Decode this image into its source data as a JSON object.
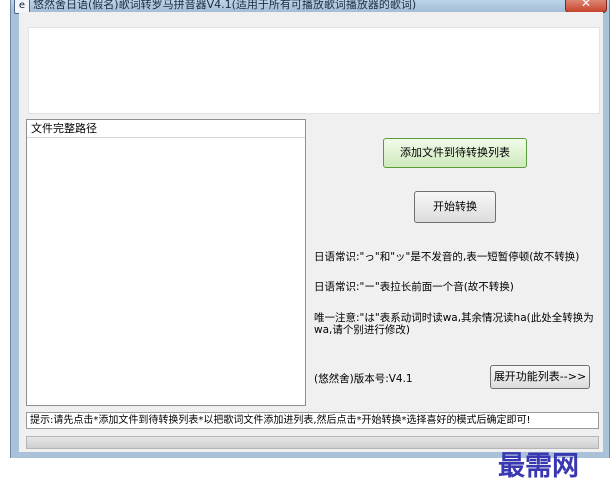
{
  "window": {
    "title": "悠然舍日语(假名)歌词转罗马拼音器V4.1(适用于所有可播放歌词播放器的歌词)",
    "close_glyph": "✕",
    "icon_name": "app-logo-icon"
  },
  "file_list": {
    "header": "文件完整路径"
  },
  "buttons": {
    "add_files": "添加文件到待转换列表",
    "start": "开始转换",
    "expand": "展开功能列表-->>"
  },
  "notes": {
    "tip1": "日语常识:\"っ\"和\"ッ\"是不发音的,表一短暂停顿(故不转换)",
    "tip2": "日语常识:\"ー\"表拉长前面一个音(故不转换)",
    "tip3": "唯一注意:\"は\"表系动词时读wa,其余情况读ha(此处全转换为wa,请个别进行修改)",
    "version": "(悠然舍)版本号:V4.1"
  },
  "status": {
    "hint": "提示:请先点击*添加文件到待转换列表*以把歌词文件添加进列表,然后点击*开始转换*选择喜好的模式后确定即可!"
  },
  "watermark": "最需网",
  "colors": {
    "frame": "#a9c2d9",
    "client": "#f0f0f0",
    "watermark": "#3a38b0"
  }
}
